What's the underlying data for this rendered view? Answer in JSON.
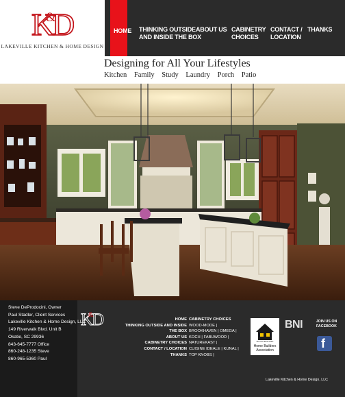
{
  "brand": {
    "logo_letters": "K&D",
    "name": "LAKEVILLE KITCHEN & HOME DESIGN",
    "accent_color": "#e8121a"
  },
  "nav": {
    "items": [
      {
        "label": "HOME",
        "active": true
      },
      {
        "label": "THINKING OUTSIDE AND INSIDE THE BOX",
        "line1": "THINKING OUTSIDE",
        "line2": "AND INSIDE THE BOX"
      },
      {
        "label": "ABOUT US"
      },
      {
        "label": "CABINETRY CHOICES",
        "line1": "CABINETRY",
        "line2": "CHOICES"
      },
      {
        "label": "CONTACT / LOCATION",
        "line1": "CONTACT /",
        "line2": "LOCATION"
      },
      {
        "label": "THANKS"
      }
    ]
  },
  "tagline": {
    "title": "Designing for All Your Lifestyles",
    "rooms": [
      "Kitchen",
      "Family",
      "Study",
      "Laundry",
      "Porch",
      "Patio"
    ]
  },
  "hero": {
    "alt": "kitchen-photo"
  },
  "footer": {
    "contact": {
      "lines": [
        "Steve DeProdocini, Owner",
        "Paul Stadler, Client Services",
        "Lakeville Kitchen & Home Design, LLC",
        "149 Riverwalk Blvd. Unit B",
        "Okatie, SC 29936",
        "843-645-7777 Office",
        "860-248-1235 Steve",
        "860-965-5360 Paul"
      ]
    },
    "nav_links": [
      "HOME",
      "THINKING OUTSIDE AND INSIDE THE BOX",
      "ABOUT US",
      "CABINETRY CHOICES",
      "CONTACT / LOCATION",
      "THANKS"
    ],
    "cabinetry": {
      "heading": "CABINETRY CHOICES",
      "lines": [
        "WOOD-MODE |",
        "BROOKHAVEN | OMEGA |",
        "KOCH | FABUWOOD |",
        "NATUREKAST |",
        "CUISINE IDEALE | KUNAL |",
        "TOP KNOBS |"
      ]
    },
    "hba_label": "Home Builders Association",
    "hba_top": "HILTON HEAD AREA",
    "bni": "BNI",
    "join": {
      "line1": "JOIN US ON",
      "line2": "FACEBOOK"
    },
    "facebook_glyph": "f",
    "copyright": "Lakeville Kitchen & Home Design, LLC"
  }
}
